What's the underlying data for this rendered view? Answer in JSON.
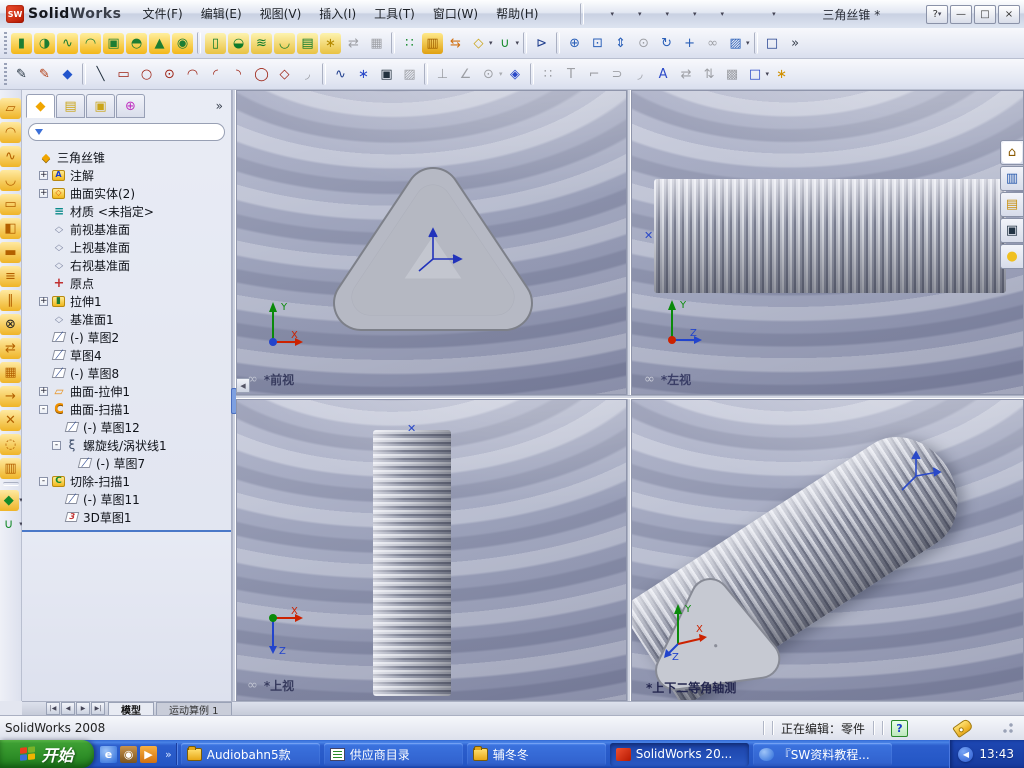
{
  "window": {
    "logo_badge": "SW",
    "logo_bold": "Solid",
    "logo_rest": "Works",
    "doc_title": "三角丝锥 *",
    "controls": [
      {
        "n": "help-button",
        "g": "?",
        "dd": "▾"
      },
      {
        "n": "minimize-button",
        "g": "—"
      },
      {
        "n": "maximize-button",
        "g": "□"
      },
      {
        "n": "close-button",
        "g": "×"
      }
    ]
  },
  "menubar": [
    "文件(F)",
    "编辑(E)",
    "视图(V)",
    "插入(I)",
    "工具(T)",
    "窗口(W)",
    "帮助(H)"
  ],
  "toolbars": {
    "standard": [
      {
        "n": "search-button",
        "k": "k-search"
      },
      {
        "sep": 1
      },
      {
        "n": "new-document-button",
        "k": "k-new",
        "dd": "▾"
      },
      {
        "n": "open-document-button",
        "k": "k-open",
        "dd": "▾"
      },
      {
        "n": "save-button",
        "k": "k-save",
        "dd": "▾"
      },
      {
        "n": "print-button",
        "k": "k-print",
        "dd": "▾"
      },
      {
        "n": "undo-button",
        "k": "k-undo",
        "dd": "▾"
      },
      {
        "n": "rebuild-button",
        "k": "k-rebuild"
      },
      {
        "n": "options-button",
        "k": "k-options",
        "dd": "▾"
      }
    ],
    "features": [
      {
        "n": "extruded-boss-button",
        "g": "▮",
        "c": "#1d7d33",
        "bg": "linear-gradient(#ffef9e,#f3b719)"
      },
      {
        "n": "revolved-boss-button",
        "g": "◑",
        "c": "#1d7d33",
        "bg": "linear-gradient(#ffef9e,#f3b719)"
      },
      {
        "n": "swept-boss-button",
        "g": "∿",
        "c": "#1d7d33",
        "bg": "linear-gradient(#ffef9e,#f3b719)"
      },
      {
        "n": "lofted-boss-button",
        "g": "◠",
        "c": "#1d7d33",
        "bg": "linear-gradient(#ffef9e,#f3b719)"
      },
      {
        "n": "boundary-boss-button",
        "g": "▣",
        "c": "#1d7d33",
        "bg": "linear-gradient(#ffef9e,#f3b719)"
      },
      {
        "n": "dome-button",
        "g": "◓",
        "c": "#1d7d33",
        "bg": "linear-gradient(#ffef9e,#f3b719)"
      },
      {
        "n": "rib-button",
        "g": "▲",
        "c": "#1d7d33",
        "bg": "linear-gradient(#ffef9e,#f3b719)"
      },
      {
        "n": "wrap-button",
        "g": "◉",
        "c": "#1d7d33",
        "bg": "linear-gradient(#ffef9e,#f3b719)"
      },
      {
        "sep": 1
      },
      {
        "n": "extruded-cut-button",
        "g": "▯",
        "c": "#0f7a2a",
        "bg": "linear-gradient(#fdf3b0,#e9c243)"
      },
      {
        "n": "revolved-cut-button",
        "g": "◒",
        "c": "#0f7a2a",
        "bg": "linear-gradient(#fdf3b0,#e9c243)"
      },
      {
        "n": "swept-cut-button",
        "g": "≋",
        "c": "#0f7a2a",
        "bg": "linear-gradient(#fdf3b0,#e9c243)"
      },
      {
        "n": "lofted-cut-button",
        "g": "◡",
        "c": "#0f7a2a",
        "bg": "linear-gradient(#fdf3b0,#e9c243)"
      },
      {
        "n": "thickened-cut-button",
        "g": "▤",
        "c": "#0f7a2a",
        "bg": "linear-gradient(#fdf3b0,#e9c243)"
      },
      {
        "n": "hole-wizard-button",
        "g": "∗",
        "c": "#b58a00",
        "bg": "linear-gradient(#fdf3b0,#e9c243)"
      },
      {
        "n": "mirror-button",
        "g": "⇄",
        "dis": 1
      },
      {
        "n": "insert-part-button",
        "g": "▦",
        "dis": 1
      },
      {
        "sep": 1
      },
      {
        "n": "linear-pattern-button",
        "g": "∷",
        "c": "#158a2a"
      },
      {
        "n": "toolbox-button",
        "g": "▥",
        "c": "#a06000",
        "bg": "linear-gradient(#ffe98a,#e0a010)"
      },
      {
        "n": "move-copy-body-button",
        "g": "⇆",
        "c": "#d07010"
      },
      {
        "n": "instant3d-button",
        "g": "◇",
        "c": "#caa418",
        "dd": "▾"
      },
      {
        "n": "curves-button",
        "g": "∪",
        "c": "#158a2a",
        "dd": "▾"
      },
      {
        "sep": 1
      },
      {
        "n": "select-button",
        "g": "⊳",
        "c": "#23418f"
      },
      {
        "sep": 1
      },
      {
        "n": "zoom-to-fit-button",
        "g": "⊕",
        "c": "#2a5fb8"
      },
      {
        "n": "zoom-to-area-button",
        "g": "⊡",
        "c": "#2a5fb8"
      },
      {
        "n": "zoom-in-out-button",
        "g": "⇕",
        "c": "#2a5fb8"
      },
      {
        "n": "zoom-to-selection-button",
        "g": "⊙",
        "dis": 1
      },
      {
        "n": "rotate-view-button",
        "g": "↻",
        "c": "#2a5fb8"
      },
      {
        "n": "pan-button",
        "g": "+",
        "c": "#2a5fb8"
      },
      {
        "n": "link-views-button",
        "g": "∞",
        "dis": 1
      },
      {
        "n": "apply-scene-button",
        "g": "▨",
        "c": "#2a5fb8",
        "dd": "▾"
      },
      {
        "sep": 1
      },
      {
        "n": "view-settings-button",
        "g": "□",
        "c": "#23418f"
      },
      {
        "n": "features-more-chevron",
        "g": "»",
        "c": "#39414f"
      }
    ],
    "sketch": [
      {
        "n": "sketch-button",
        "g": "✎",
        "c": "#23313f"
      },
      {
        "n": "sketch-3d-button",
        "g": "✎",
        "c": "#b03a10"
      },
      {
        "n": "smart-dimension-button",
        "g": "◆",
        "c": "#2255cc"
      },
      {
        "sep": 1
      },
      {
        "n": "line-button",
        "g": "╲",
        "c": "#23313f"
      },
      {
        "n": "corner-rectangle-button",
        "g": "▭",
        "c": "#9c1f10"
      },
      {
        "n": "circle-button",
        "g": "○",
        "c": "#9c1f10"
      },
      {
        "n": "perimeter-circle-button",
        "g": "⊙",
        "c": "#9c1f10"
      },
      {
        "n": "centerpoint-arc-button",
        "g": "◠",
        "c": "#9c1f10"
      },
      {
        "n": "tangent-arc-button",
        "g": "◜",
        "c": "#9c1f10"
      },
      {
        "n": "three-point-arc-button",
        "g": "◝",
        "c": "#9c1f10"
      },
      {
        "n": "ellipse-button",
        "g": "◯",
        "c": "#9c1f10"
      },
      {
        "n": "polygon-button",
        "g": "◇",
        "c": "#9c1f10"
      },
      {
        "n": "sketch-fillet-button",
        "g": "◞",
        "dis": 1
      },
      {
        "sep": 1
      },
      {
        "n": "spline-button",
        "g": "∿",
        "c": "#23418f"
      },
      {
        "n": "point-button",
        "g": "∗",
        "c": "#2a49c8"
      },
      {
        "n": "convert-entities-button",
        "g": "▣",
        "c": "#23313f"
      },
      {
        "n": "face-curves-button",
        "g": "▨",
        "dis": 1
      },
      {
        "sep": 1
      },
      {
        "n": "add-relation-button",
        "g": "⊥",
        "dis": 1
      },
      {
        "n": "display-relations-button",
        "g": "∠",
        "dis": 1
      },
      {
        "n": "quick-snaps-button",
        "g": "⊙",
        "dis": 1,
        "dd": "▾"
      },
      {
        "n": "mirror-entities-button",
        "g": "◈",
        "c": "#2a49c8"
      },
      {
        "sep": 1
      },
      {
        "n": "linear-sketch-pattern-button",
        "g": "∷",
        "dis": 1
      },
      {
        "n": "trim-entities-button",
        "g": "T",
        "dis": 1
      },
      {
        "n": "extend-entities-button",
        "g": "⌐",
        "dis": 1
      },
      {
        "n": "offset-entities-button",
        "g": "⊃",
        "dis": 1
      },
      {
        "n": "sketch-chamfer-button",
        "g": "◞",
        "dis": 1
      },
      {
        "n": "text-button",
        "g": "A",
        "c": "#2a49c8"
      },
      {
        "n": "modify-sketch-button",
        "g": "⇄",
        "dis": 1
      },
      {
        "n": "move-entities-button",
        "g": "⇅",
        "dis": 1
      },
      {
        "n": "sketch-picture-button",
        "g": "▩",
        "dis": 1
      },
      {
        "n": "sketch-plane-button",
        "g": "□",
        "c": "#2a49c8",
        "dd": "▾"
      },
      {
        "n": "construction-geometry-button",
        "g": "∗",
        "c": "#d09000"
      }
    ],
    "surfaces": [
      {
        "n": "extruded-surface-button",
        "g": "▱",
        "c": "#b36000",
        "bg": "linear-gradient(#ffe9a0,#efb428)"
      },
      {
        "n": "revolved-surface-button",
        "g": "◠",
        "c": "#b36000",
        "bg": "linear-gradient(#ffe9a0,#efb428)"
      },
      {
        "n": "swept-surface-button",
        "g": "∿",
        "c": "#b36000",
        "bg": "linear-gradient(#ffe9a0,#efb428)"
      },
      {
        "n": "lofted-surface-button",
        "g": "◡",
        "c": "#b36000",
        "bg": "linear-gradient(#ffe9a0,#efb428)"
      },
      {
        "n": "boundary-surface-button",
        "g": "▭",
        "c": "#b36000",
        "bg": "linear-gradient(#ffe9a0,#efb428)"
      },
      {
        "n": "filled-surface-button",
        "g": "◧",
        "c": "#b36000",
        "bg": "linear-gradient(#ffe9a0,#efb428)"
      },
      {
        "n": "planar-surface-button",
        "g": "▬",
        "c": "#b36000",
        "bg": "linear-gradient(#ffe9a0,#efb428)"
      },
      {
        "n": "offset-surface-button",
        "g": "≡",
        "c": "#b36000",
        "bg": "linear-gradient(#ffe9a0,#efb428)"
      },
      {
        "n": "ruled-surface-button",
        "g": "∥",
        "c": "#b36000",
        "bg": "linear-gradient(#ffe9a0,#efb428)"
      },
      {
        "n": "delete-face-button",
        "g": "⊗",
        "c": "#222222",
        "bg": "linear-gradient(#ffe9a0,#efb428)"
      },
      {
        "n": "replace-face-button",
        "g": "⇄",
        "c": "#b36000",
        "bg": "linear-gradient(#ffe9a0,#efb428)"
      },
      {
        "n": "knit-surface-button",
        "g": "▦",
        "c": "#b36000",
        "bg": "linear-gradient(#ffe9a0,#efb428)"
      },
      {
        "n": "extend-surface-button",
        "g": "→",
        "c": "#b36000",
        "bg": "linear-gradient(#ffe9a0,#efb428)"
      },
      {
        "n": "trim-surface-button",
        "g": "✕",
        "c": "#b36000",
        "bg": "linear-gradient(#ffe9a0,#efb428)"
      },
      {
        "n": "untrim-surface-button",
        "g": "◌",
        "c": "#b36000",
        "bg": "linear-gradient(#ffe9a0,#efb428)"
      },
      {
        "n": "thicken-button",
        "g": "▥",
        "c": "#b36000",
        "bg": "linear-gradient(#ffe9a0,#efb428)"
      },
      {
        "sep": 1
      },
      {
        "n": "face-fillet-button",
        "g": "◆",
        "c": "#158a2a",
        "bg": "linear-gradient(#ffe9a0,#efb428)",
        "dd": "▾"
      },
      {
        "n": "surface-curves-button",
        "g": "∪",
        "c": "#158a2a",
        "dd": "▾"
      }
    ],
    "taskpane": [
      {
        "n": "solidworks-resources-tab",
        "g": "⌂",
        "c": "#8a5a00",
        "bg": "#ffffff"
      },
      {
        "n": "design-library-tab",
        "g": "▥",
        "c": "#2255aa"
      },
      {
        "n": "file-explorer-tab",
        "g": "▤",
        "c": "#c79012"
      },
      {
        "n": "view-palette-tab",
        "g": "▣",
        "c": "#223344"
      },
      {
        "n": "appearances-tab",
        "g": "●",
        "c": "#f0c020"
      }
    ]
  },
  "feature_manager": {
    "tabs": [
      {
        "n": "featuremanager-design-tree-tab",
        "g": "◆",
        "c": "#f0a500",
        "active": 1
      },
      {
        "n": "propertymanager-tab",
        "g": "▤",
        "c": "#caa418"
      },
      {
        "n": "configurationmanager-tab",
        "g": "▣",
        "c": "#caa418"
      },
      {
        "n": "dimxpertmanager-tab",
        "g": "⊕",
        "c": "#c030c0"
      }
    ],
    "more_glyph": "»",
    "filter_value": "",
    "tree": [
      {
        "label": "三角丝锥",
        "level": 0,
        "expand": "",
        "icon": "part"
      },
      {
        "label": "注解",
        "level": 1,
        "expand": "+",
        "icon": "annotations"
      },
      {
        "label": "曲面实体(2)",
        "level": 1,
        "expand": "+",
        "icon": "surface-folder"
      },
      {
        "label": "材质 <未指定>",
        "level": 1,
        "expand": "",
        "icon": "material"
      },
      {
        "label": "前视基准面",
        "level": 1,
        "expand": "",
        "icon": "plane"
      },
      {
        "label": "上视基准面",
        "level": 1,
        "expand": "",
        "icon": "plane"
      },
      {
        "label": "右视基准面",
        "level": 1,
        "expand": "",
        "icon": "plane"
      },
      {
        "label": "原点",
        "level": 1,
        "expand": "",
        "icon": "origin"
      },
      {
        "label": "拉伸1",
        "level": 1,
        "expand": "+",
        "icon": "extrude"
      },
      {
        "label": "基准面1",
        "level": 1,
        "expand": "",
        "icon": "plane"
      },
      {
        "label": "(-) 草图2",
        "level": 1,
        "expand": "",
        "icon": "sketch"
      },
      {
        "label": "草图4",
        "level": 1,
        "expand": "",
        "icon": "sketch"
      },
      {
        "label": "(-) 草图8",
        "level": 1,
        "expand": "",
        "icon": "sketch"
      },
      {
        "label": "曲面-拉伸1",
        "level": 1,
        "expand": "+",
        "icon": "surface-extrude"
      },
      {
        "label": "曲面-扫描1",
        "level": 1,
        "expand": "-",
        "icon": "surface-sweep"
      },
      {
        "label": "(-) 草图12",
        "level": 2,
        "expand": "",
        "icon": "sketch"
      },
      {
        "label": "螺旋线/涡状线1",
        "level": 2,
        "expand": "-",
        "icon": "helix"
      },
      {
        "label": "(-) 草图7",
        "level": 3,
        "expand": "",
        "icon": "sketch"
      },
      {
        "label": "切除-扫描1",
        "level": 1,
        "expand": "-",
        "icon": "cut-sweep"
      },
      {
        "label": "(-) 草图11",
        "level": 2,
        "expand": "",
        "icon": "sketch"
      },
      {
        "label": "3D草图1",
        "level": 2,
        "expand": "",
        "icon": "sketch3d"
      }
    ]
  },
  "viewports": [
    {
      "name": "front",
      "label": "*前视",
      "link": "∞",
      "axes": {
        "v": "Y",
        "h": "X"
      }
    },
    {
      "name": "left",
      "label": "*左视",
      "link": "∞",
      "axes": {
        "v": "Y",
        "h": "Z"
      }
    },
    {
      "name": "top",
      "label": "*上视",
      "link": "∞",
      "axes": {
        "h": "X",
        "d": "Z"
      }
    },
    {
      "name": "dimetric",
      "label": "*上下二等角轴测",
      "link": "",
      "axes": {
        "v": "Y",
        "h": "X",
        "d": "Z"
      }
    }
  ],
  "model_tabs": {
    "nav": [
      "|◀",
      "◀",
      "▶",
      "▶|"
    ],
    "tabs": [
      {
        "label": "模型",
        "active": 1
      },
      {
        "label": "运动算例 1"
      }
    ]
  },
  "statusbar": {
    "app": "SolidWorks 2008",
    "editing": "正在编辑：零件"
  },
  "taskbar": {
    "start_label": "开始",
    "quick_launch": [
      {
        "n": "internet-explorer-icon",
        "g": "e",
        "bg": "radial-gradient(circle at 35% 30%,#9ec4f8,#2a6ad8)"
      },
      {
        "n": "messenger-icon",
        "g": "◉",
        "bg": "linear-gradient(#c8924a,#7a5420)"
      },
      {
        "n": "media-player-icon",
        "g": "▶",
        "bg": "linear-gradient(#f8b040,#d07010)"
      }
    ],
    "quick_launch_chevron": "»",
    "buttons": [
      {
        "name": "taskbar-audiobahn-button",
        "label": "Audiobahn5款",
        "icon": "folder"
      },
      {
        "name": "taskbar-supplier-directory-button",
        "label": "供应商目录",
        "icon": "doc"
      },
      {
        "name": "taskbar-fudongdong-button",
        "label": "辅冬冬",
        "icon": "folder"
      },
      {
        "name": "taskbar-solidworks-button",
        "label": "SolidWorks 20...",
        "icon": "sw",
        "active": 1
      },
      {
        "name": "taskbar-sw-tutorial-button",
        "label": "『SW资料教程...",
        "icon": "ie"
      }
    ],
    "tray_chevron": "◀",
    "clock": "13:43"
  },
  "colors": {
    "taskbar_blue": "#2456c4",
    "start_green": "#2f8f28",
    "accent_gold": "#f3b719",
    "viewport_label": "#23264e",
    "splitter_blue": "#4a78c8"
  }
}
